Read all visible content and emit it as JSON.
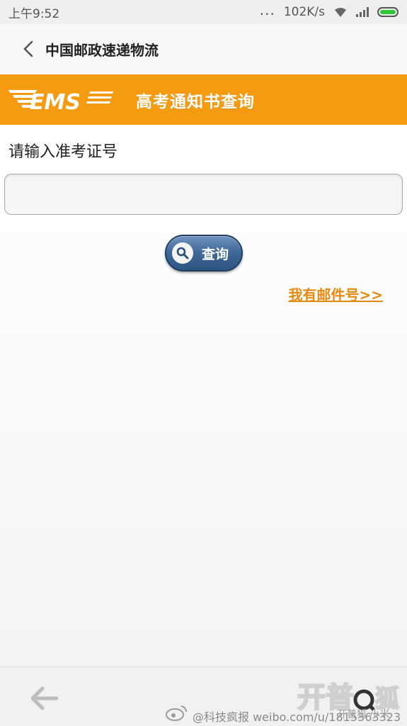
{
  "status_bar": {
    "time": "上午9:52",
    "dots": "...",
    "network_speed": "102K/s",
    "battery_color": "#30c838"
  },
  "nav": {
    "title": "中国邮政速递物流",
    "back_icon": "chevron-left-icon"
  },
  "banner": {
    "logo_text": "EMS",
    "title": "高考通知书查询",
    "bg_color": "#f49b12"
  },
  "form": {
    "label": "请输入准考证号",
    "input_value": "",
    "input_placeholder": "",
    "button_label": "查询",
    "button_icon": "search-icon",
    "button_color": "#3d6796"
  },
  "link": {
    "text": "我有邮件号>>",
    "color": "#e98a10"
  },
  "bottom_bar": {
    "back_icon": "arrow-left-icon",
    "watermark": "@科技疯报  weibo.com/u/1815363323",
    "site_logo_text": "开普狐 小米"
  }
}
